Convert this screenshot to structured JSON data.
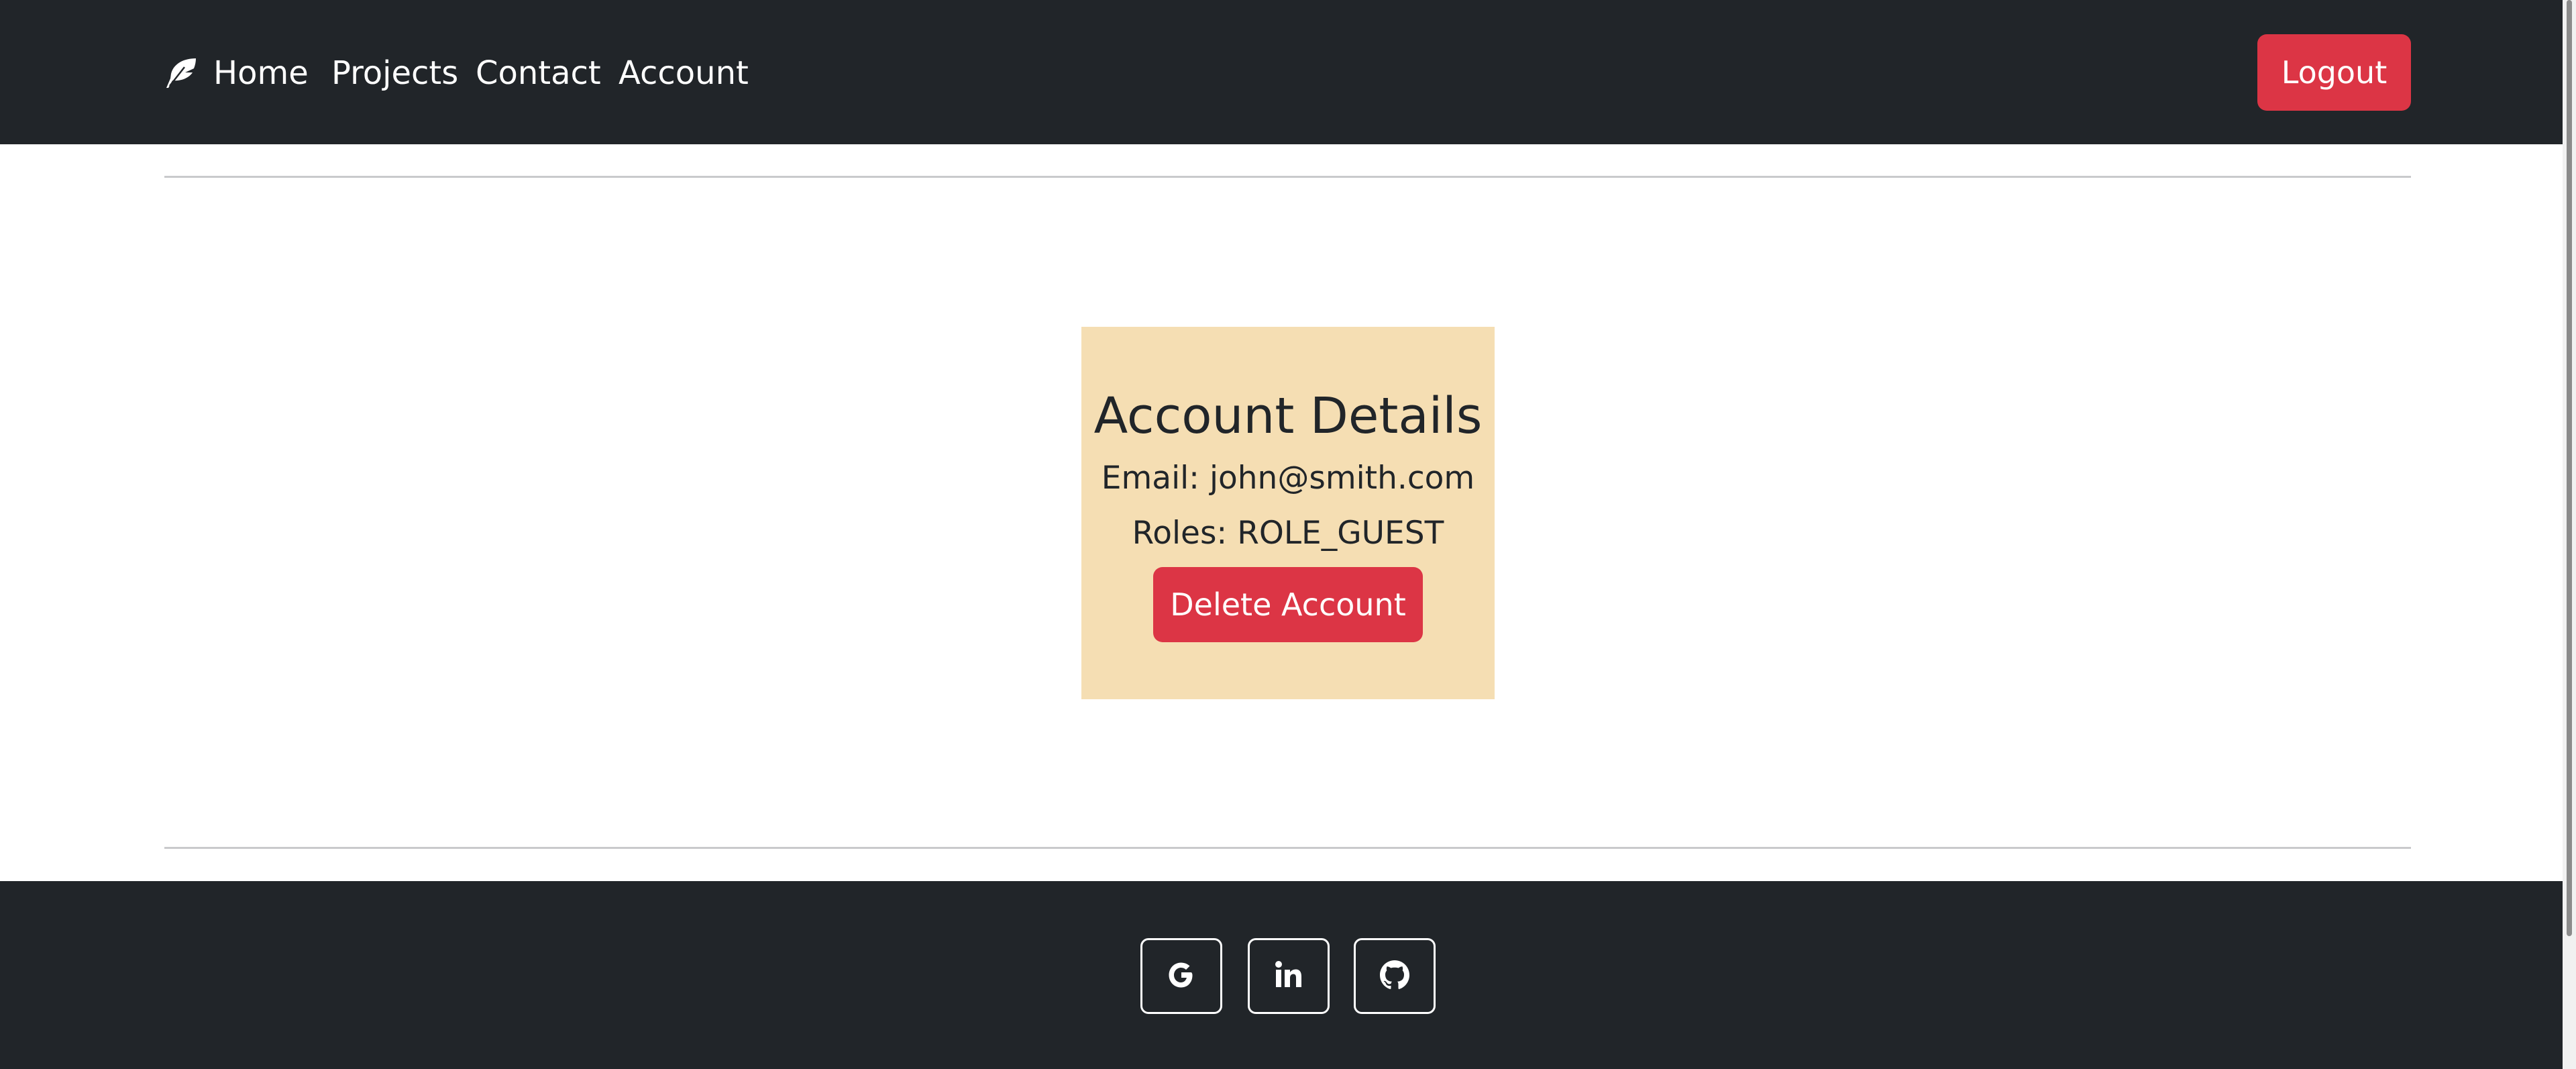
{
  "navbar": {
    "brand_icon": "feather-icon",
    "links": [
      {
        "label": "Home"
      },
      {
        "label": "Projects"
      },
      {
        "label": "Contact"
      },
      {
        "label": "Account"
      }
    ],
    "logout_label": "Logout"
  },
  "account": {
    "title": "Account Details",
    "email_line": "Email: john@smith.com",
    "roles_line": "Roles: ROLE_GUEST",
    "delete_label": "Delete Account"
  },
  "footer": {
    "social_links": [
      {
        "icon": "google-icon"
      },
      {
        "icon": "linkedin-icon"
      },
      {
        "icon": "github-icon"
      }
    ]
  },
  "colors": {
    "dark_bg": "#212529",
    "danger": "#dc3545",
    "card_bg": "#f5deb3",
    "text": "#212529"
  }
}
